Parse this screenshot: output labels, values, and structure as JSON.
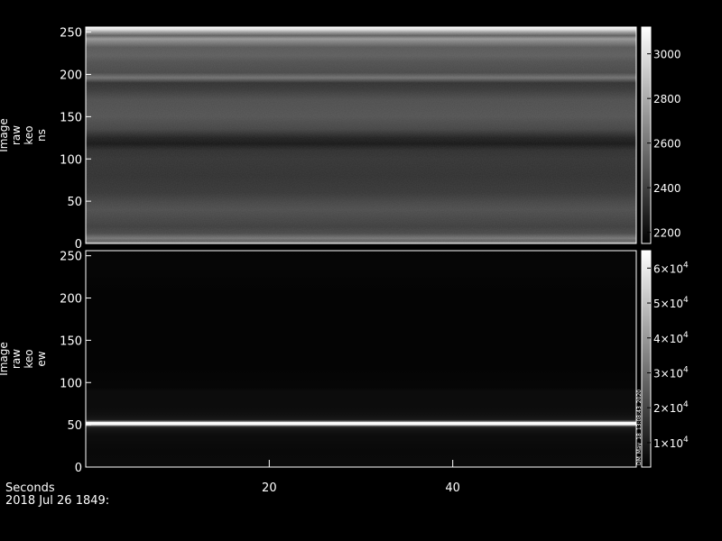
{
  "chart_data": [
    {
      "type": "heatmap",
      "panel": "top",
      "ylabel_lines": [
        "Image",
        "raw",
        "keo",
        "ns"
      ],
      "xlim": [
        0,
        60
      ],
      "ylim": [
        0,
        256
      ],
      "yticks": [
        0,
        50,
        100,
        150,
        200,
        250
      ],
      "colorbar": {
        "range": [
          2150,
          3120
        ],
        "ticks": [
          {
            "value": 2200,
            "label": "2200"
          },
          {
            "value": 2400,
            "label": "2400"
          },
          {
            "value": 2600,
            "label": "2600"
          },
          {
            "value": 2800,
            "label": "2800"
          },
          {
            "value": 3000,
            "label": "3000"
          }
        ]
      },
      "row_profile": [
        {
          "y": 0,
          "v": 2750
        },
        {
          "y": 3,
          "v": 2500
        },
        {
          "y": 6,
          "v": 2600
        },
        {
          "y": 12,
          "v": 2420
        },
        {
          "y": 20,
          "v": 2380
        },
        {
          "y": 40,
          "v": 2440
        },
        {
          "y": 50,
          "v": 2400
        },
        {
          "y": 60,
          "v": 2350
        },
        {
          "y": 80,
          "v": 2330
        },
        {
          "y": 100,
          "v": 2340
        },
        {
          "y": 110,
          "v": 2320
        },
        {
          "y": 118,
          "v": 2230
        },
        {
          "y": 125,
          "v": 2270
        },
        {
          "y": 135,
          "v": 2400
        },
        {
          "y": 150,
          "v": 2460
        },
        {
          "y": 170,
          "v": 2440
        },
        {
          "y": 182,
          "v": 2360
        },
        {
          "y": 190,
          "v": 2330
        },
        {
          "y": 196,
          "v": 2580
        },
        {
          "y": 202,
          "v": 2420
        },
        {
          "y": 215,
          "v": 2450
        },
        {
          "y": 222,
          "v": 2500
        },
        {
          "y": 232,
          "v": 2480
        },
        {
          "y": 238,
          "v": 2620
        },
        {
          "y": 242,
          "v": 2720
        },
        {
          "y": 246,
          "v": 2500
        },
        {
          "y": 250,
          "v": 2750
        },
        {
          "y": 253,
          "v": 3000
        },
        {
          "y": 256,
          "v": 3080
        }
      ]
    },
    {
      "type": "heatmap",
      "panel": "bottom",
      "ylabel_lines": [
        "Image",
        "raw",
        "keo",
        "ew"
      ],
      "xlim": [
        0,
        60
      ],
      "ylim": [
        0,
        256
      ],
      "xticks": [
        20,
        40
      ],
      "yticks": [
        0,
        50,
        100,
        150,
        200,
        250
      ],
      "colorbar": {
        "range": [
          3000,
          65000
        ],
        "ticks": [
          {
            "value": 10000,
            "mantissa": "1",
            "exponent": "4"
          },
          {
            "value": 20000,
            "mantissa": "2",
            "exponent": "4"
          },
          {
            "value": 30000,
            "mantissa": "3",
            "exponent": "4"
          },
          {
            "value": 40000,
            "mantissa": "4",
            "exponent": "4"
          },
          {
            "value": 50000,
            "mantissa": "5",
            "exponent": "4"
          },
          {
            "value": 60000,
            "mantissa": "6",
            "exponent": "4"
          }
        ],
        "times_sign": "×10"
      },
      "side_text": "DM_May_18_13:08:43_2020",
      "row_profile": [
        {
          "y": 0,
          "v": 5500
        },
        {
          "y": 20,
          "v": 5200
        },
        {
          "y": 38,
          "v": 6200
        },
        {
          "y": 44,
          "v": 8000
        },
        {
          "y": 47,
          "v": 9500
        },
        {
          "y": 49,
          "v": 30000
        },
        {
          "y": 50,
          "v": 64000
        },
        {
          "y": 53,
          "v": 64000
        },
        {
          "y": 54,
          "v": 30000
        },
        {
          "y": 56,
          "v": 9000
        },
        {
          "y": 62,
          "v": 7000
        },
        {
          "y": 70,
          "v": 6000
        },
        {
          "y": 90,
          "v": 5800
        },
        {
          "y": 94,
          "v": 4500
        },
        {
          "y": 120,
          "v": 4000
        },
        {
          "y": 200,
          "v": 4000
        },
        {
          "y": 222,
          "v": 4100
        },
        {
          "y": 228,
          "v": 4500
        },
        {
          "y": 245,
          "v": 4400
        },
        {
          "y": 256,
          "v": 4300
        }
      ]
    }
  ],
  "footer": {
    "xaxis_label": "Seconds",
    "date": "2018 Jul 26 1849:"
  }
}
